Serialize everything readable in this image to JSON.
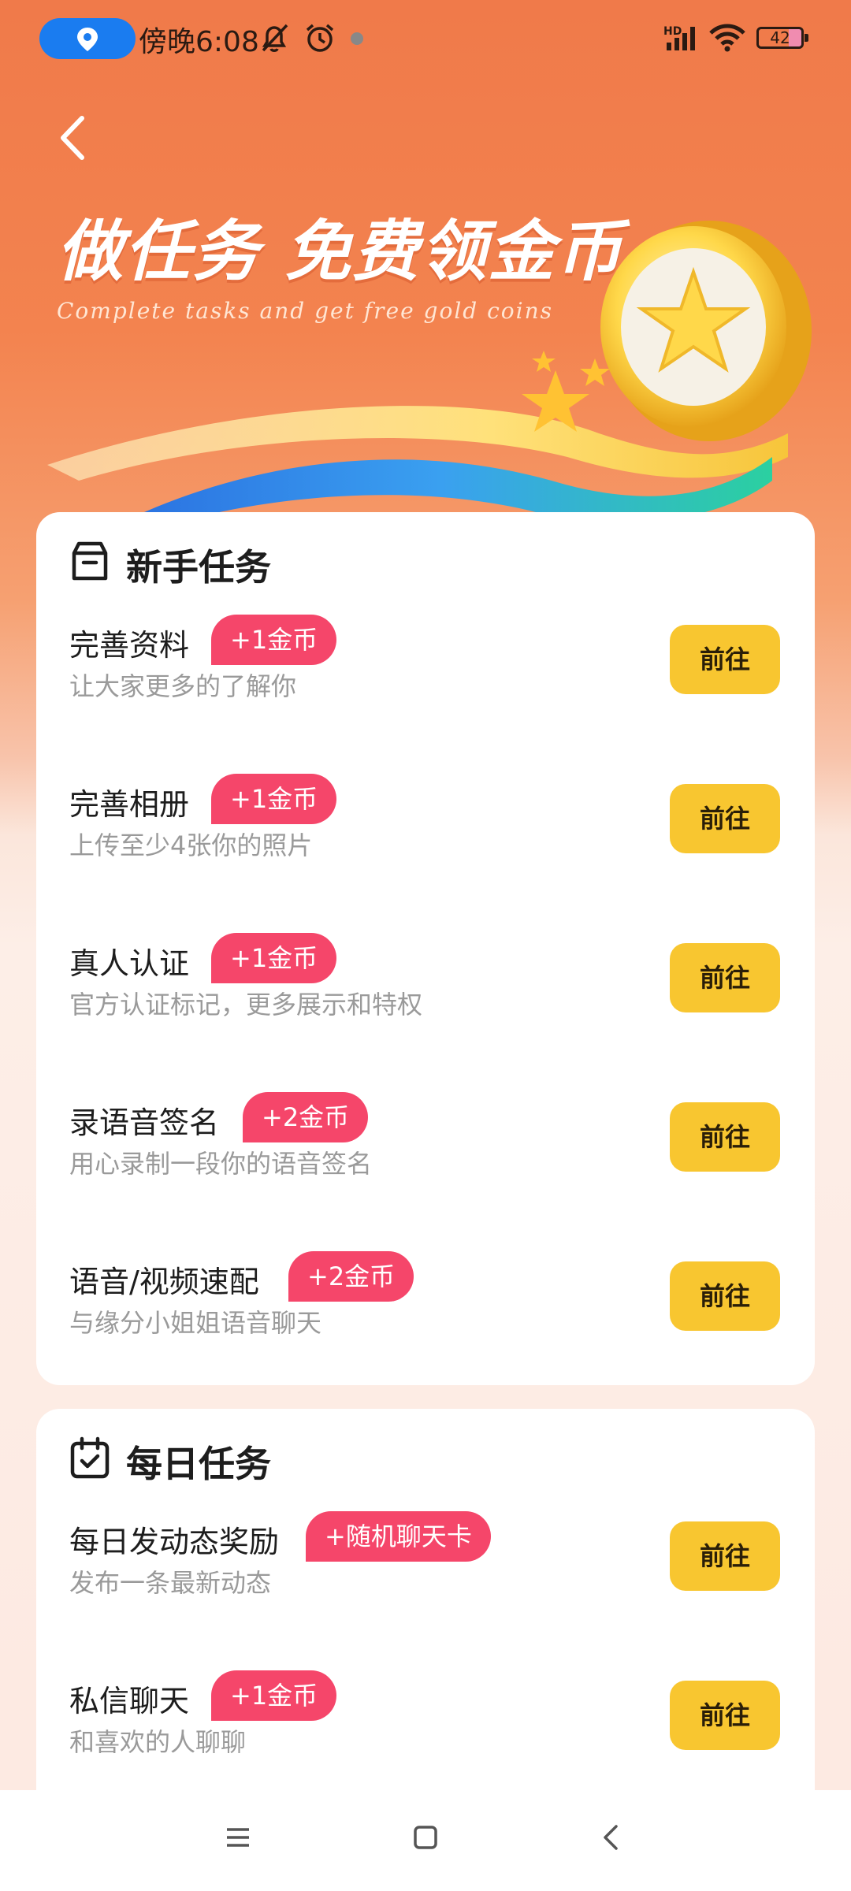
{
  "status_bar": {
    "time": "傍晚6:08",
    "network": "HD",
    "battery": "42"
  },
  "header": {
    "title": "做任务 免费领金币",
    "subtitle": "Complete tasks and get free gold coins"
  },
  "newbie": {
    "title": "新手任务",
    "tasks": [
      {
        "title": "完善资料",
        "reward": "+1金币",
        "desc": "让大家更多的了解你",
        "button": "前往"
      },
      {
        "title": "完善相册",
        "reward": "+1金币",
        "desc": "上传至少4张你的照片",
        "button": "前往"
      },
      {
        "title": "真人认证",
        "reward": "+1金币",
        "desc": "官方认证标记，更多展示和特权",
        "button": "前往"
      },
      {
        "title": "录语音签名",
        "reward": "+2金币",
        "desc": "用心录制一段你的语音签名",
        "button": "前往"
      },
      {
        "title": "语音/视频速配",
        "reward": "+2金币",
        "desc": "与缘分小姐姐语音聊天",
        "button": "前往"
      }
    ]
  },
  "daily": {
    "title": "每日任务",
    "tasks": [
      {
        "title": "每日发动态奖励",
        "reward": "+随机聊天卡",
        "desc": "发布一条最新动态",
        "button": "前往"
      },
      {
        "title": "私信聊天",
        "reward": "+1金币",
        "desc": "和喜欢的人聊聊",
        "button": "前往"
      }
    ]
  },
  "icons": {
    "back": "chevron-left-icon",
    "newbie": "box-icon",
    "daily": "calendar-check-icon",
    "nav_menu": "menu-icon",
    "nav_home": "square-icon",
    "nav_back": "triangle-back-icon"
  },
  "colors": {
    "header_orange": "#f07a4a",
    "badge_pink": "#f5466a",
    "button_yellow": "#f8c630"
  }
}
